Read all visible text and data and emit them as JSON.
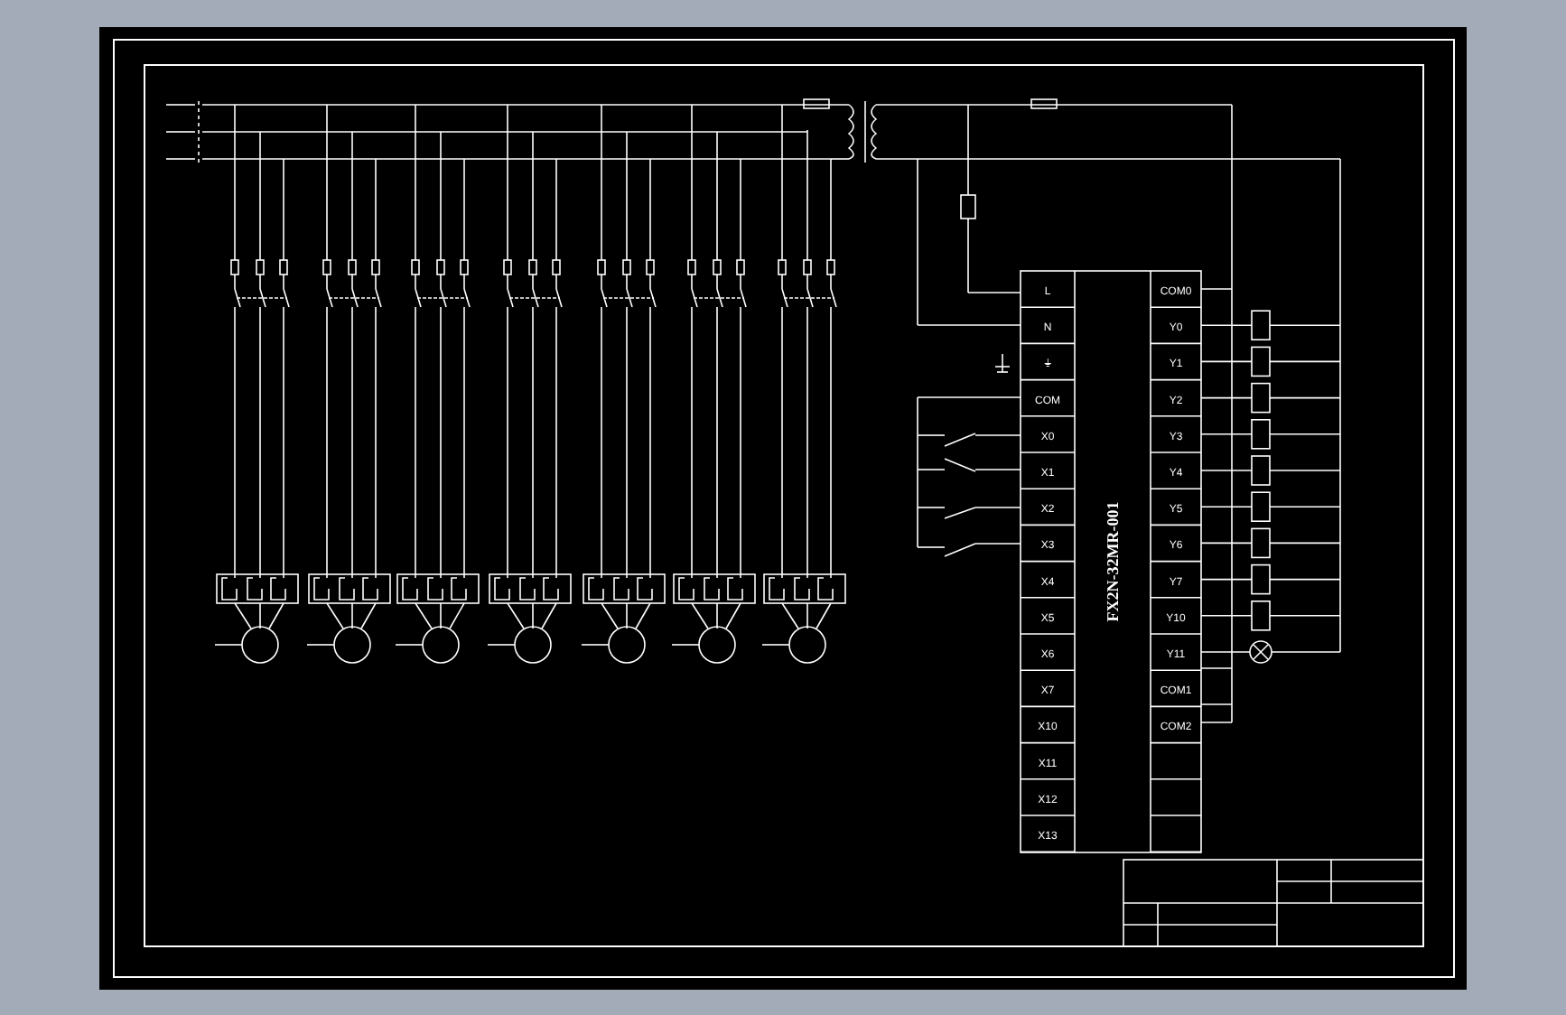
{
  "plc": {
    "model": "FX2N-32MR-001",
    "inputs": [
      "L",
      "N",
      "⏚",
      "COM",
      "X0",
      "X1",
      "X2",
      "X3",
      "X4",
      "X5",
      "X6",
      "X7",
      "X10",
      "X11",
      "X12",
      "X13"
    ],
    "outputs": [
      "COM0",
      "Y0",
      "Y1",
      "Y2",
      "Y3",
      "Y4",
      "Y5",
      "Y6",
      "Y7",
      "Y10",
      "Y11",
      "COM1",
      "COM2"
    ]
  }
}
